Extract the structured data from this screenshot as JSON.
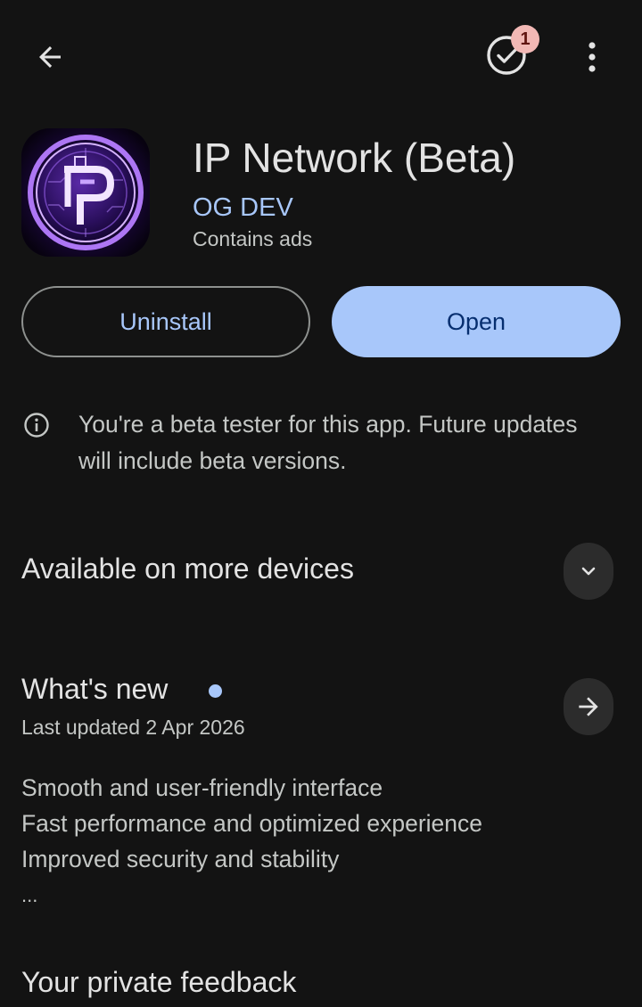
{
  "app": {
    "title": "IP Network (Beta)",
    "developer": "OG DEV",
    "ads_notice": "Contains ads",
    "icon": "ip-network-logo"
  },
  "toolbar": {
    "back_icon": "arrow-back-icon",
    "updates_icon": "check-circle-icon",
    "updates_badge": "1",
    "more_icon": "more-vertical-icon"
  },
  "actions": {
    "uninstall_label": "Uninstall",
    "open_label": "Open"
  },
  "beta": {
    "message": "You're a beta tester for this app. Future updates will include beta versions.",
    "icon": "info-icon"
  },
  "devices": {
    "title": "Available on more devices",
    "icon": "chevron-down-icon"
  },
  "whats_new": {
    "title": "What's new",
    "updated": "Last updated 2 Apr 2026",
    "notes": [
      "Smooth and user-friendly interface",
      "Fast performance and optimized experience",
      "Improved security and stability"
    ],
    "more": "...",
    "icon": "arrow-forward-icon"
  },
  "feedback": {
    "title": "Your private feedback"
  },
  "colors": {
    "background": "#131313",
    "accent": "#a8c7fa",
    "on_accent": "#062e6f",
    "badge": "#f2b8b5"
  }
}
